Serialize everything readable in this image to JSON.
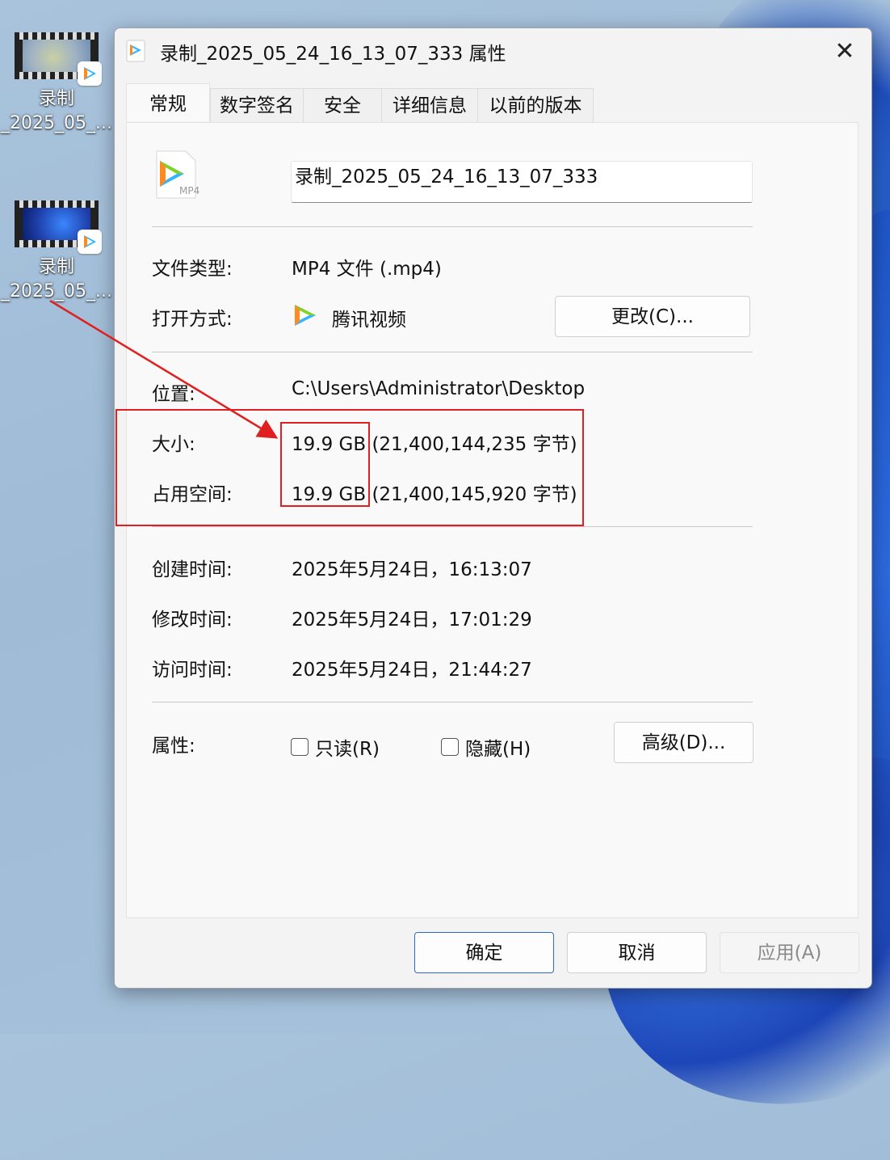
{
  "desktop": {
    "icons": [
      {
        "label_line1": "录制",
        "label_line2": "_2025_05_..."
      },
      {
        "label_line1": "录制",
        "label_line2": "_2025_05_..."
      }
    ]
  },
  "dialog": {
    "title": "录制_2025_05_24_16_13_07_333 属性",
    "tabs": [
      "常规",
      "数字签名",
      "安全",
      "详细信息",
      "以前的版本"
    ],
    "active_tab": "常规",
    "file_icon_ext": "MP4",
    "filename": "录制_2025_05_24_16_13_07_333",
    "file_type_label": "文件类型:",
    "file_type_value": "MP4 文件 (.mp4)",
    "open_with_label": "打开方式:",
    "open_with_value": "腾讯视频",
    "change_button": "更改(C)...",
    "location_label": "位置:",
    "location_value": "C:\\Users\\Administrator\\Desktop",
    "size_label": "大小:",
    "size_value": "19.9 GB",
    "size_bytes": "(21,400,144,235 字节)",
    "size_on_disk_label": "占用空间:",
    "size_on_disk_value": "19.9 GB",
    "size_on_disk_bytes": "(21,400,145,920 字节)",
    "created_label": "创建时间:",
    "created_value": "2025年5月24日，16:13:07",
    "modified_label": "修改时间:",
    "modified_value": "2025年5月24日，17:01:29",
    "accessed_label": "访问时间:",
    "accessed_value": "2025年5月24日，21:44:27",
    "attributes_label": "属性:",
    "readonly_label": "只读(R)",
    "hidden_label": "隐藏(H)",
    "readonly_checked": false,
    "hidden_checked": false,
    "advanced_button": "高级(D)...",
    "ok_button": "确定",
    "cancel_button": "取消",
    "apply_button": "应用(A)"
  },
  "colors": {
    "annotation_red": "#e02020",
    "primary_border": "#2d6cc6"
  }
}
